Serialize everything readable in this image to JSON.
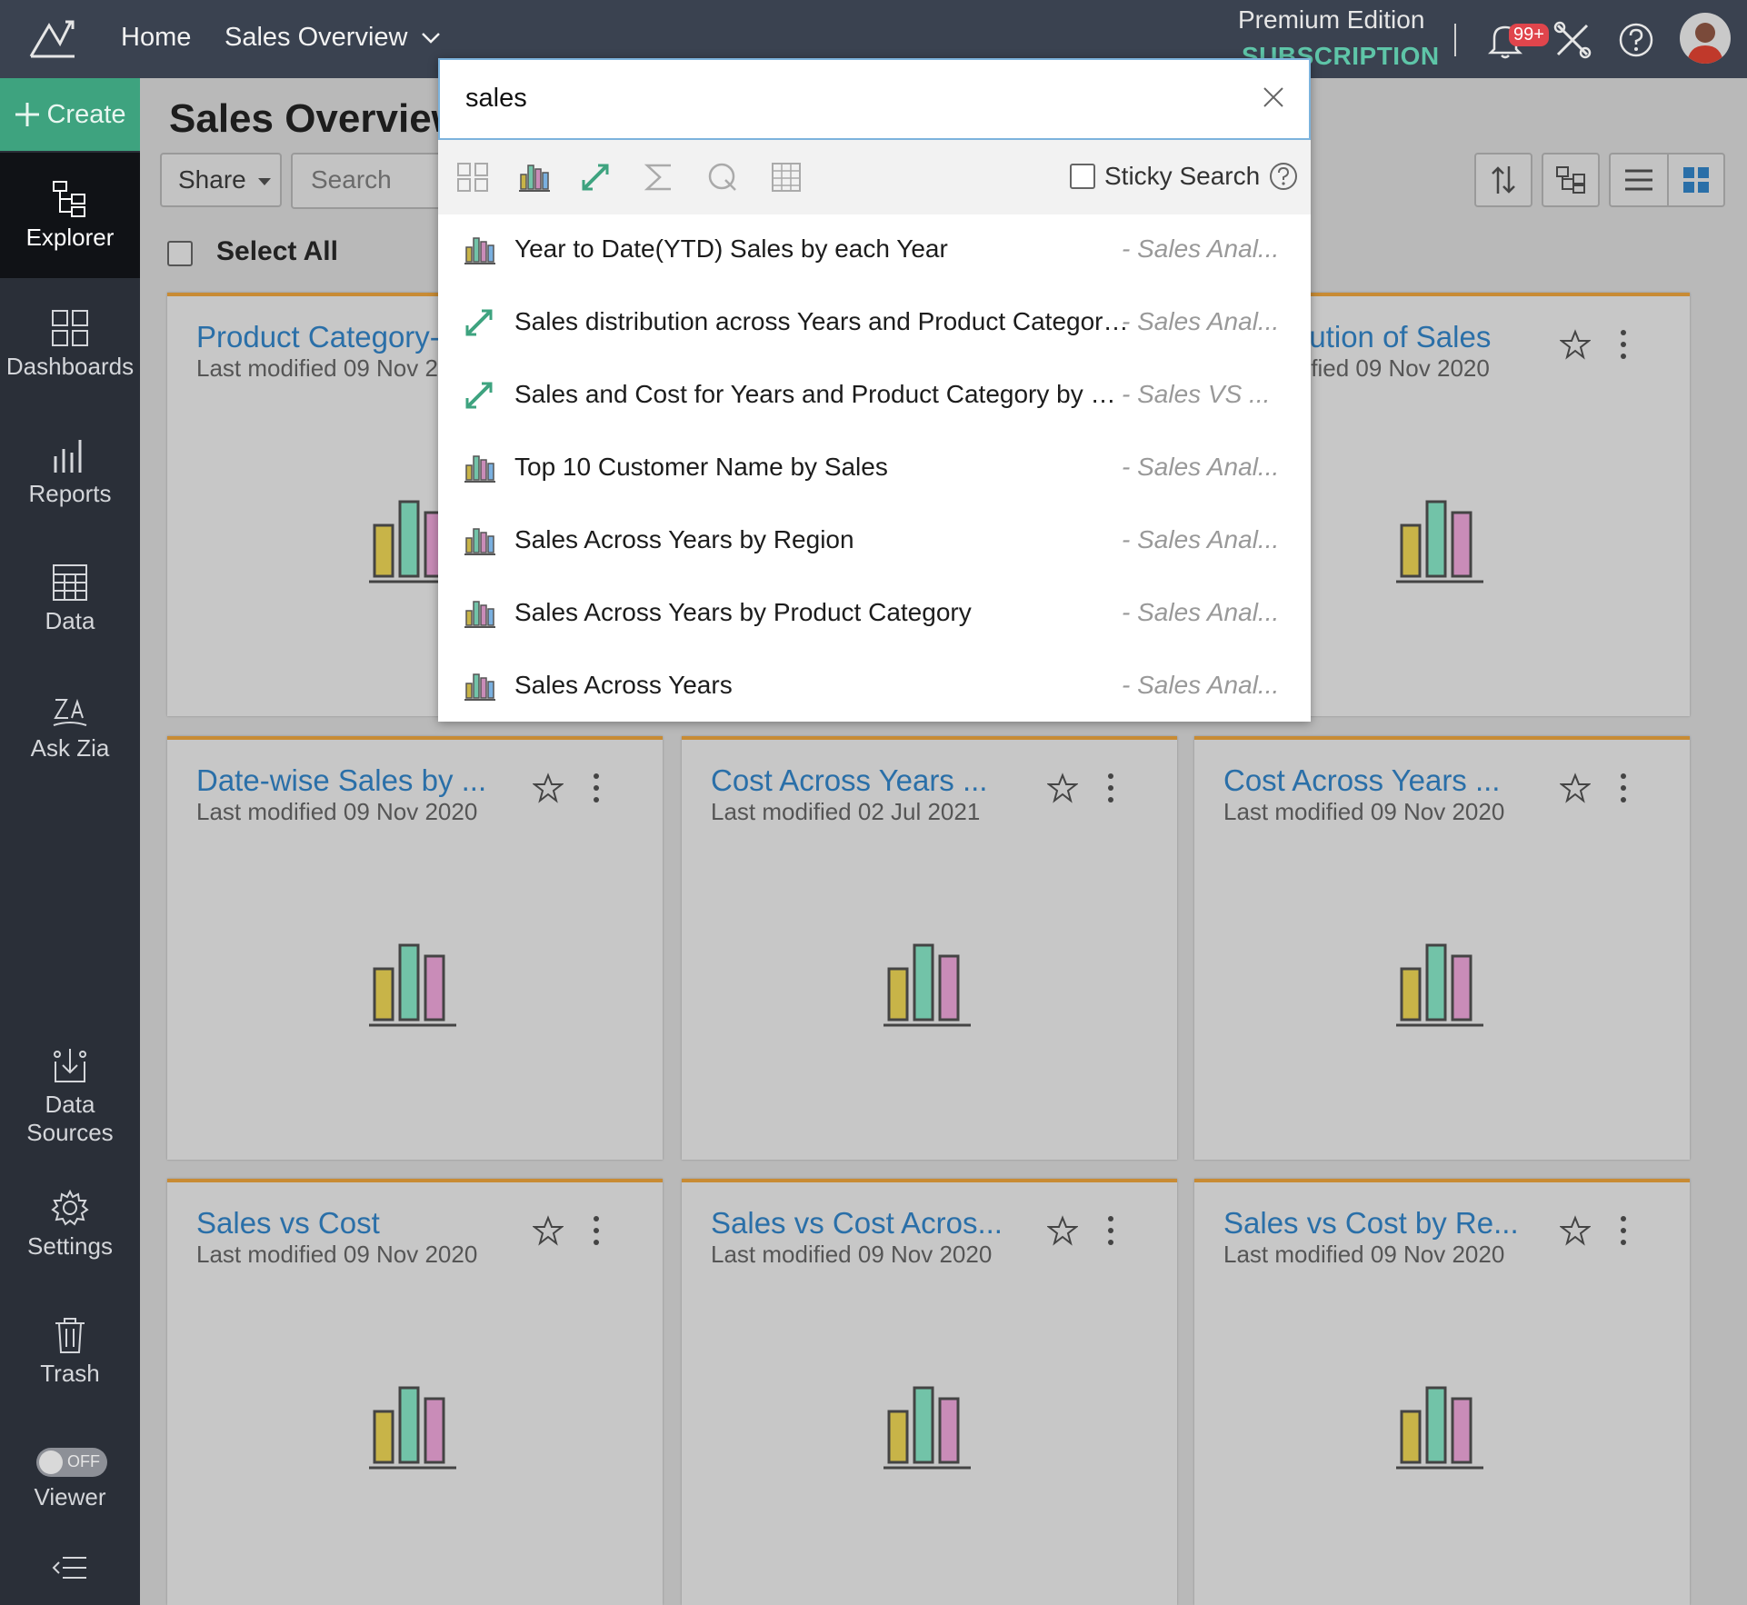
{
  "topbar": {
    "home": "Home",
    "workspace": "Sales Overview",
    "edition": "Premium Edition",
    "subscription": "SUBSCRIPTION",
    "notification_count": "99+"
  },
  "sidebar": {
    "create": "Create",
    "items": [
      {
        "label": "Explorer",
        "icon": "explorer-icon"
      },
      {
        "label": "Dashboards",
        "icon": "dashboards-icon"
      },
      {
        "label": "Reports",
        "icon": "reports-icon"
      },
      {
        "label": "Data",
        "icon": "data-icon"
      },
      {
        "label": "Ask Zia",
        "icon": "zia-icon"
      },
      {
        "label": "Data",
        "label2": "Sources",
        "icon": "data-sources-icon"
      },
      {
        "label": "Settings",
        "icon": "gear-icon"
      },
      {
        "label": "Trash",
        "icon": "trash-icon"
      },
      {
        "label": "Viewer",
        "icon": "toggle"
      }
    ],
    "viewer_toggle": "OFF"
  },
  "main": {
    "title": "Sales Overview",
    "share": "Share",
    "search_placeholder": "Search",
    "select_all": "Select All",
    "cards": [
      {
        "title": "Product Category-…",
        "sub": "Last modified 09 Nov 20"
      },
      {
        "title": "bution of Sales",
        "sub": "dified 09 Nov 2020"
      },
      {
        "title": "Date-wise Sales by ...",
        "sub": "Last modified 09 Nov 2020"
      },
      {
        "title": "Cost Across Years ...",
        "sub": "Last modified 02 Jul 2021"
      },
      {
        "title": "Cost Across Years ...",
        "sub": "Last modified 09 Nov 2020"
      },
      {
        "title": "Sales vs Cost",
        "sub": "Last modified 09 Nov 2020"
      },
      {
        "title": "Sales vs Cost Acros...",
        "sub": "Last modified 09 Nov 2020"
      },
      {
        "title": "Sales vs Cost by Re...",
        "sub": "Last modified 09 Nov 2020"
      }
    ]
  },
  "search_popup": {
    "query": "sales",
    "sticky_label": "Sticky Search",
    "results": [
      {
        "title": "Year to Date(YTD) Sales by each Year",
        "source": "- Sales Anal...",
        "icon": "bar-chart-icon"
      },
      {
        "title": "Sales distribution across Years and Product Category...",
        "source": "- Sales Anal...",
        "icon": "pivot-icon"
      },
      {
        "title": "Sales and Cost for Years and Product Category by Re...",
        "source": "- Sales VS ...",
        "icon": "pivot-icon"
      },
      {
        "title": "Top 10 Customer Name by Sales",
        "source": "- Sales Anal...",
        "icon": "bar-chart-icon"
      },
      {
        "title": "Sales Across Years by Region",
        "source": "- Sales Anal...",
        "icon": "bar-chart-icon"
      },
      {
        "title": "Sales Across Years by Product Category",
        "source": "- Sales Anal...",
        "icon": "bar-chart-icon"
      },
      {
        "title": "Sales Across Years",
        "source": "- Sales Anal...",
        "icon": "bar-chart-icon"
      }
    ]
  },
  "colors": {
    "accent_green": "#3ea37f",
    "link_blue": "#2a6fa8",
    "card_border": "#c88b34",
    "bar_yellow": "#c8b448",
    "bar_teal": "#72c3a8",
    "bar_pink": "#c98cb8"
  }
}
